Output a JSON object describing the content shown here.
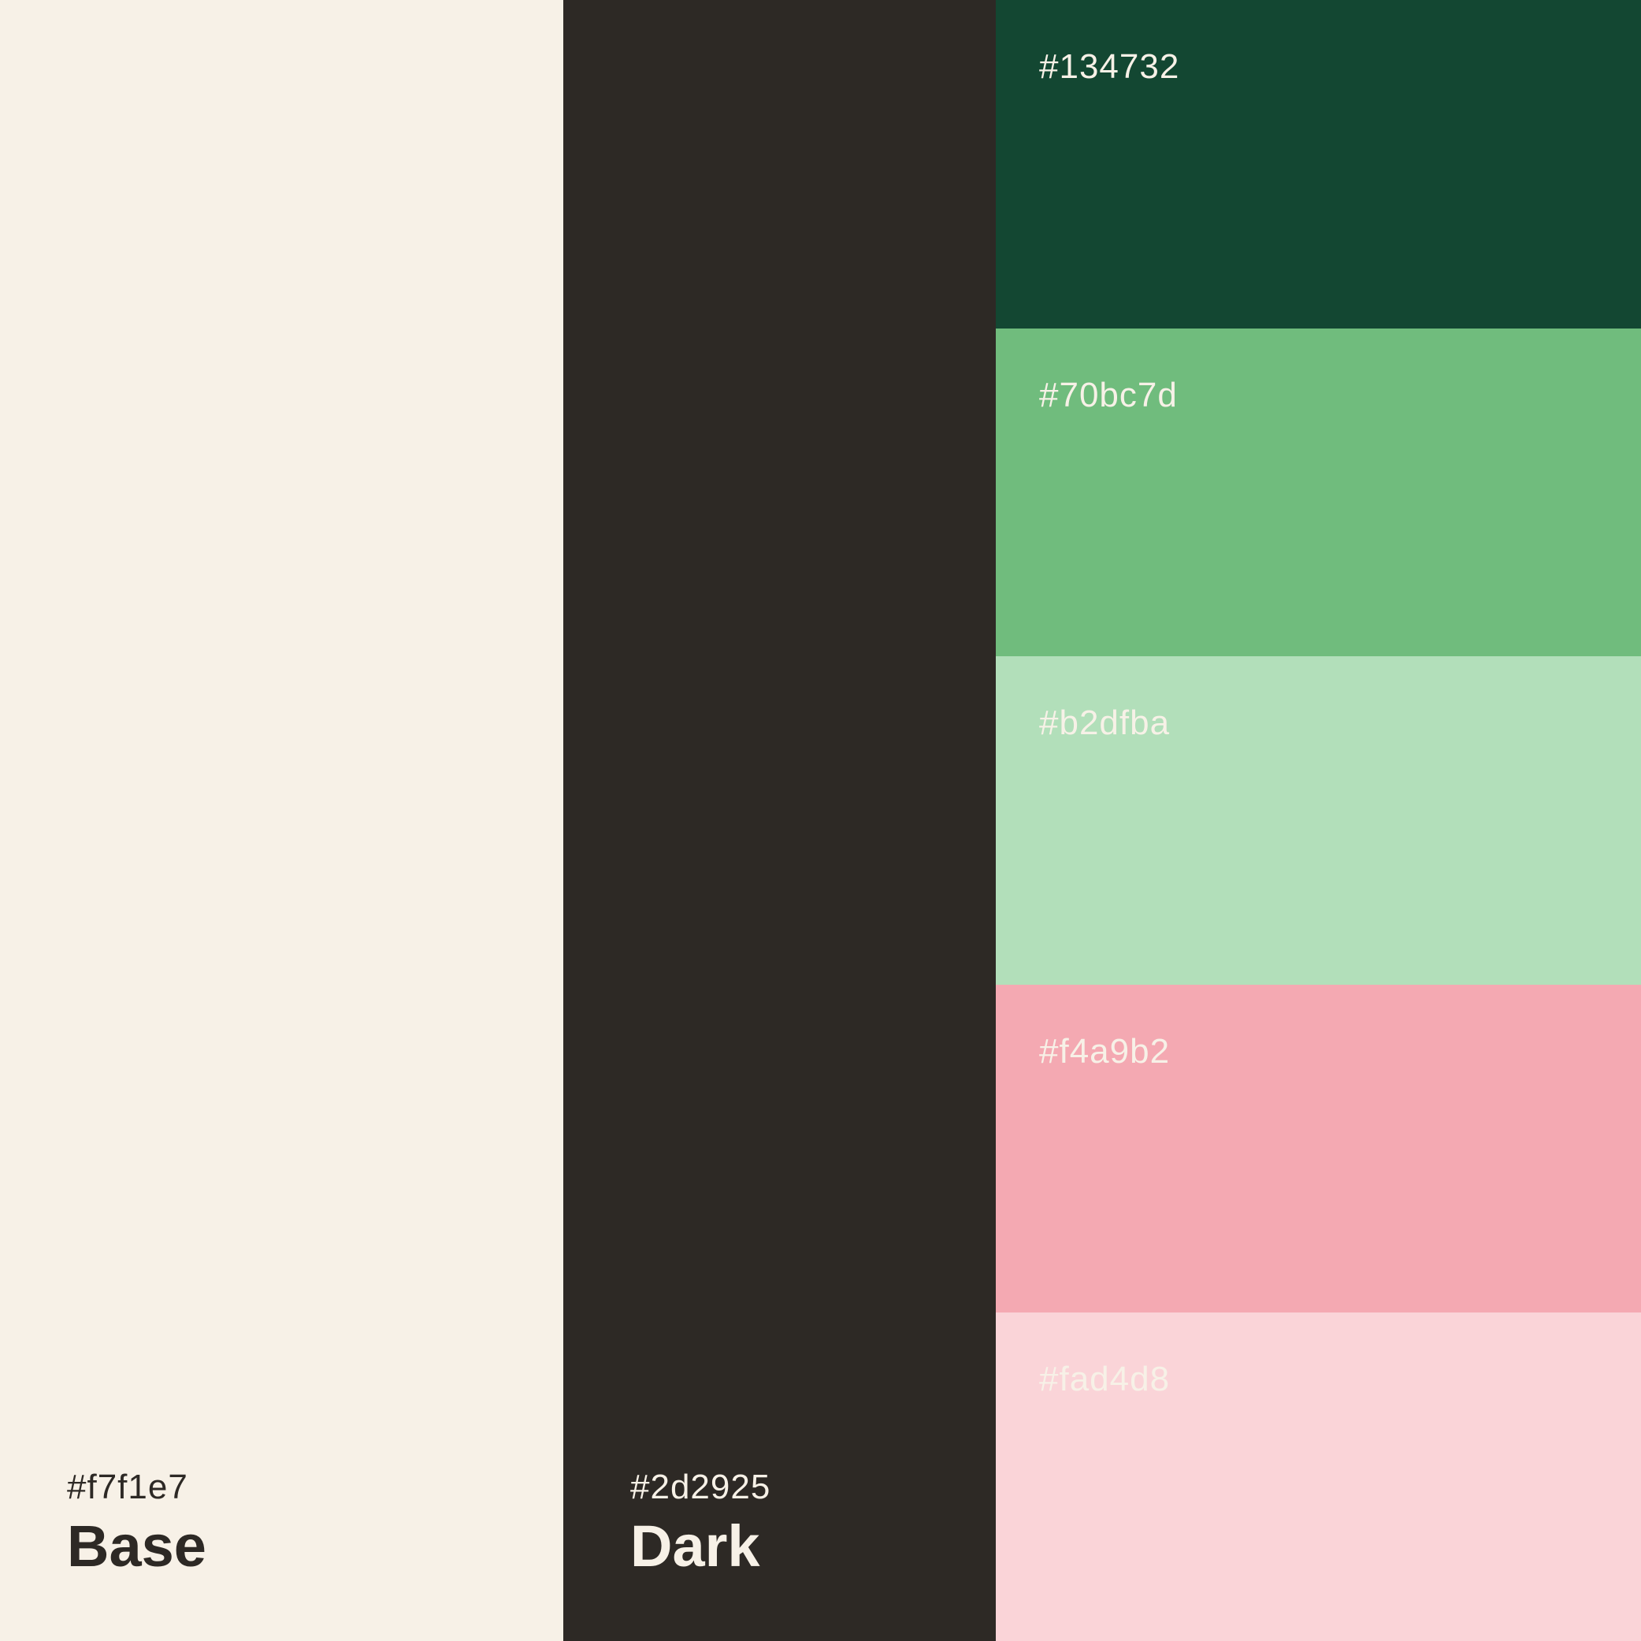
{
  "base": {
    "hex": "#f7f1e7",
    "name": "Base",
    "color": "#f7f1e7",
    "text_color": "#2d2925"
  },
  "dark": {
    "hex": "#2d2925",
    "name": "Dark",
    "color": "#2d2925",
    "text_color": "#f7f1e7"
  },
  "accents": [
    {
      "hex": "#134732",
      "color": "#134732",
      "text_color": "#f7f1e7"
    },
    {
      "hex": "#70bc7d",
      "color": "#70bc7d",
      "text_color": "#f7f1e7"
    },
    {
      "hex": "#b2dfba",
      "color": "#b2dfba",
      "text_color": "#f7f1e7"
    },
    {
      "hex": "#f4a9b2",
      "color": "#f4a9b2",
      "text_color": "#f7f1e7"
    },
    {
      "hex": "#fad4d8",
      "color": "#fad4d8",
      "text_color": "#f7f1e7"
    }
  ]
}
